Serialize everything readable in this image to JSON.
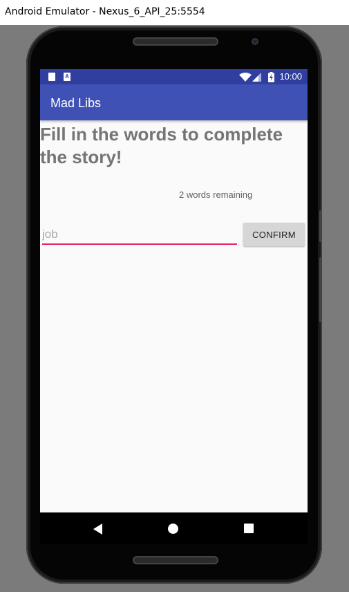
{
  "window": {
    "title": "Android Emulator - Nexus_6_API_25:5554"
  },
  "statusbar": {
    "time": "10:00",
    "icons": [
      "sd-card-icon",
      "a-notification-icon",
      "wifi-icon",
      "signal-icon",
      "battery-charging-icon"
    ],
    "color": "#303f9f"
  },
  "appbar": {
    "title": "Mad Libs",
    "color": "#3f51b5"
  },
  "main": {
    "heading": "Fill in the words to complete the story!",
    "remaining_text": "2 words remaining",
    "input": {
      "value": "",
      "placeholder": "job",
      "underline_color": "#e91e63"
    },
    "confirm_label": "CONFIRM"
  },
  "navbar": {
    "icons": [
      "back-icon",
      "home-icon",
      "recents-icon"
    ]
  }
}
